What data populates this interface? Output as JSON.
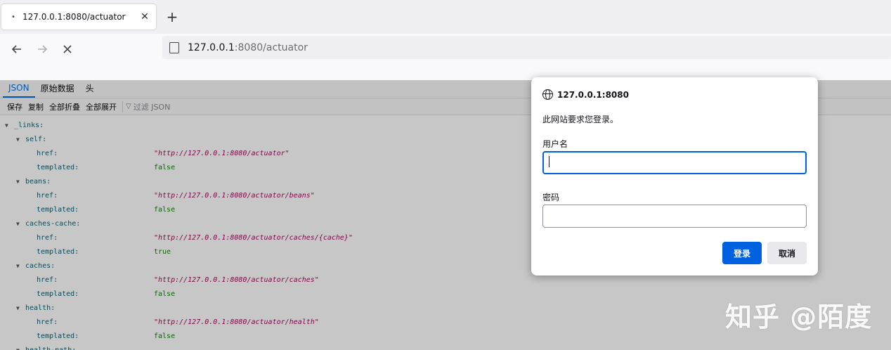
{
  "browser": {
    "tab_title": "127.0.0.1:8080/actuator",
    "url_host": "127.0.0.1",
    "url_path": ":8080/actuator"
  },
  "viewer": {
    "tabs": [
      "JSON",
      "原始数据",
      "头"
    ],
    "toolbar": [
      "保存",
      "复制",
      "全部折叠",
      "全部展开"
    ],
    "filter_placeholder": "过滤 JSON",
    "rows": [
      {
        "level": 0,
        "key": "_links:",
        "twisty": true
      },
      {
        "level": 1,
        "key": "self:",
        "twisty": true
      },
      {
        "level": 2,
        "key": "href:",
        "value": "\"http://127.0.0.1:8080/actuator\"",
        "type": "str"
      },
      {
        "level": 2,
        "key": "templated:",
        "value": "false",
        "type": "bool"
      },
      {
        "level": 1,
        "key": "beans:",
        "twisty": true
      },
      {
        "level": 2,
        "key": "href:",
        "value": "\"http://127.0.0.1:8080/actuator/beans\"",
        "type": "str"
      },
      {
        "level": 2,
        "key": "templated:",
        "value": "false",
        "type": "bool"
      },
      {
        "level": 1,
        "key": "caches-cache:",
        "twisty": true
      },
      {
        "level": 2,
        "key": "href:",
        "value": "\"http://127.0.0.1:8080/actuator/caches/{cache}\"",
        "type": "str"
      },
      {
        "level": 2,
        "key": "templated:",
        "value": "true",
        "type": "bool"
      },
      {
        "level": 1,
        "key": "caches:",
        "twisty": true
      },
      {
        "level": 2,
        "key": "href:",
        "value": "\"http://127.0.0.1:8080/actuator/caches\"",
        "type": "str"
      },
      {
        "level": 2,
        "key": "templated:",
        "value": "false",
        "type": "bool"
      },
      {
        "level": 1,
        "key": "health:",
        "twisty": true
      },
      {
        "level": 2,
        "key": "href:",
        "value": "\"http://127.0.0.1:8080/actuator/health\"",
        "type": "str"
      },
      {
        "level": 2,
        "key": "templated:",
        "value": "false",
        "type": "bool"
      },
      {
        "level": 1,
        "key": "health-path:",
        "twisty": true
      }
    ]
  },
  "dialog": {
    "host": "127.0.0.1:8080",
    "message": "此网站要求您登录。",
    "username_label": "用户名",
    "username_value": "",
    "password_label": "密码",
    "password_value": "",
    "login_label": "登录",
    "cancel_label": "取消"
  },
  "watermark": "知乎 @陌度",
  "colors": {
    "accent": "#0061e0",
    "json_key": "#0b6375",
    "json_string": "#a00c5b",
    "json_bool": "#058b00"
  }
}
